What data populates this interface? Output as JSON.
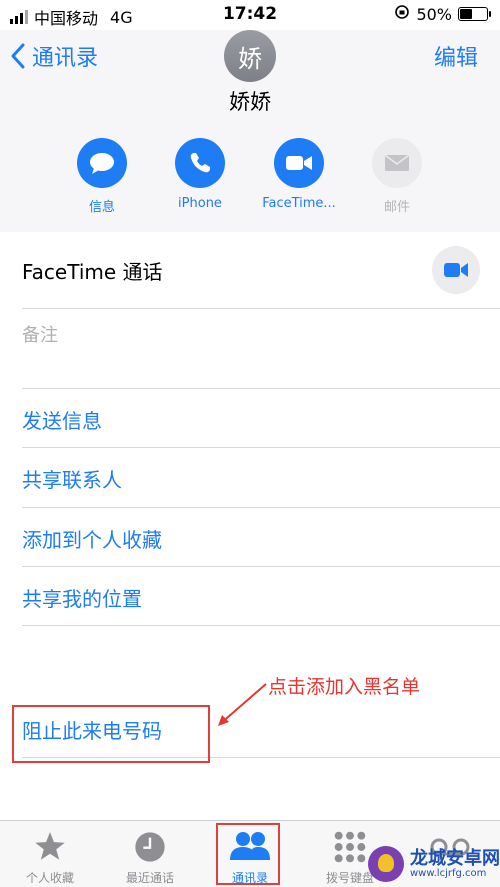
{
  "status": {
    "carrier": "中国移动",
    "network": "4G",
    "time": "17:42",
    "battery": "50%",
    "battery_level": 0.5
  },
  "nav": {
    "back_label": "通讯录",
    "edit_label": "编辑"
  },
  "contact": {
    "avatar_initial": "娇",
    "name": "娇娇"
  },
  "actions": [
    {
      "label": "信息",
      "icon": "message-icon",
      "enabled": true
    },
    {
      "label": "iPhone",
      "icon": "phone-icon",
      "enabled": true
    },
    {
      "label": "FaceTime...",
      "icon": "video-icon",
      "enabled": true
    },
    {
      "label": "邮件",
      "icon": "mail-icon",
      "enabled": false
    }
  ],
  "facetime_row": {
    "label": "FaceTime 通话"
  },
  "notes_row": {
    "label": "备注"
  },
  "menu": [
    "发送信息",
    "共享联系人",
    "添加到个人收藏",
    "共享我的位置"
  ],
  "block_row": {
    "label": "阻止此来电号码"
  },
  "annotation": "点击添加入黑名单",
  "tabs": [
    {
      "label": "个人收藏",
      "icon": "star-icon",
      "active": false
    },
    {
      "label": "最近通话",
      "icon": "clock-icon",
      "active": false
    },
    {
      "label": "通讯录",
      "icon": "contacts-icon",
      "active": true
    },
    {
      "label": "拨号键盘",
      "icon": "keypad-icon",
      "active": false
    }
  ],
  "watermark": {
    "title": "龙城安卓网",
    "url": "www.lcjrfg.com"
  },
  "colors": {
    "accent": "#1e7cf5",
    "annotation": "#e5362f"
  }
}
